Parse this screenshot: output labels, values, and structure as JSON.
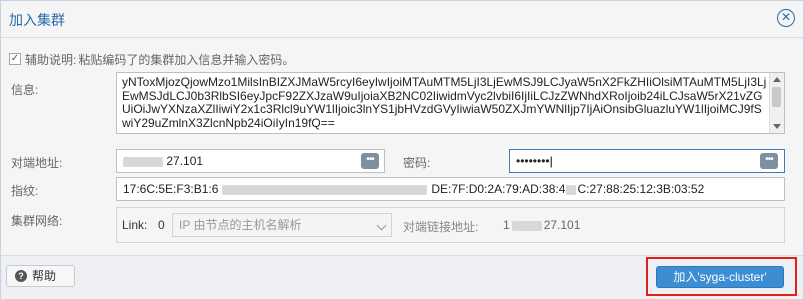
{
  "dialog": {
    "title": "加入集群",
    "close_glyph": "⊗"
  },
  "hint": {
    "checkbox_glyph": "☑",
    "label": "辅助说明:",
    "text": "粘贴编码了的集群加入信息并输入密码。"
  },
  "info": {
    "label": "信息:",
    "value": "yNToxMjozQjowMzo1MilsInBIZXJMaW5rcyI6eyIwIjoiMTAuMTM5LjI3LjEwMSJ9LCJyaW5nX2FkZHIiOlsiMTAuMTM5LjI3LjEwMSJdLCJ0b3RlbSI6eyJpcF92ZXJzaW9uIjoiaXB2NC02IiwidmVyc2lvbiI6IjIiLCJzZWNhdXRoIjoib24iLCJsaW5rX21vZGUiOiJwYXNzaXZlIiwiY2x1c3Rlcl9uYW1lIjoic3lnYS1jbHVzdGVyIiwiaW50ZXJmYWNlIjp7IjAiOnsibGluazluYW1lIjoiMCJ9fSwiY29uZmlnX3ZlcnNpb24iOiIyIn19fQ=="
  },
  "peer_address": {
    "label": "对端地址:",
    "value_suffix": "27.101"
  },
  "password": {
    "label": "密码:",
    "value": "••••••••"
  },
  "fingerprint": {
    "label": "指纹:",
    "value_start": "17:6C:5E:F3:B1:6",
    "value_mid": "DE:7F:D0:2A:79:AD:38:4",
    "value_end": "C:27:88:25:12:3B:03:52"
  },
  "cluster_network": {
    "label": "集群网络:",
    "link_label": "Link:",
    "link_number": "0",
    "select_placeholder": "IP 由节点的主机名解析",
    "peer_link_label": "对端链接地址:",
    "peer_link_prefix": "1",
    "peer_link_value": "27.101"
  },
  "footer": {
    "help_label": "帮助",
    "help_icon": "?",
    "join_label": "加入'syga-cluster'"
  }
}
